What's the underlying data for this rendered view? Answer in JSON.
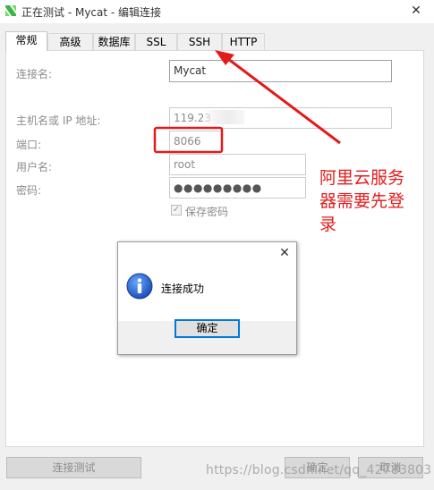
{
  "window": {
    "title": "正在测试 - Mycat - 编辑连接",
    "close_glyph": "✕"
  },
  "tabs": [
    {
      "label": "常规",
      "active": true
    },
    {
      "label": "高级"
    },
    {
      "label": "数据库"
    },
    {
      "label": "SSL"
    },
    {
      "label": "SSH"
    },
    {
      "label": "HTTP"
    }
  ],
  "form": {
    "connection_name_label": "连接名:",
    "connection_name_value": "Mycat",
    "host_label": "主机名或 IP 地址:",
    "host_value": "119.23",
    "port_label": "端口:",
    "port_value": "8066",
    "user_label": "用户名:",
    "user_value": "root",
    "password_label": "密码:",
    "password_value": "●●●●●●●●●",
    "save_password_label": "保存密码",
    "save_password_checked": true
  },
  "footer": {
    "test_button": "连接测试",
    "ok_button": "确定",
    "cancel_button": "取消"
  },
  "message_box": {
    "text": "连接成功",
    "ok_button": "确定",
    "close_glyph": "✕"
  },
  "annotation": {
    "line1": "阿里云服务",
    "line2": "器需要先登",
    "line3": "录",
    "color": "#e41a1a"
  },
  "watermark": "https://blog.csdn.net/qq_42783803",
  "colors": {
    "accent": "#0078d7",
    "annotation_red": "#e41a1a",
    "app_icon_green": "#3bb54a"
  }
}
